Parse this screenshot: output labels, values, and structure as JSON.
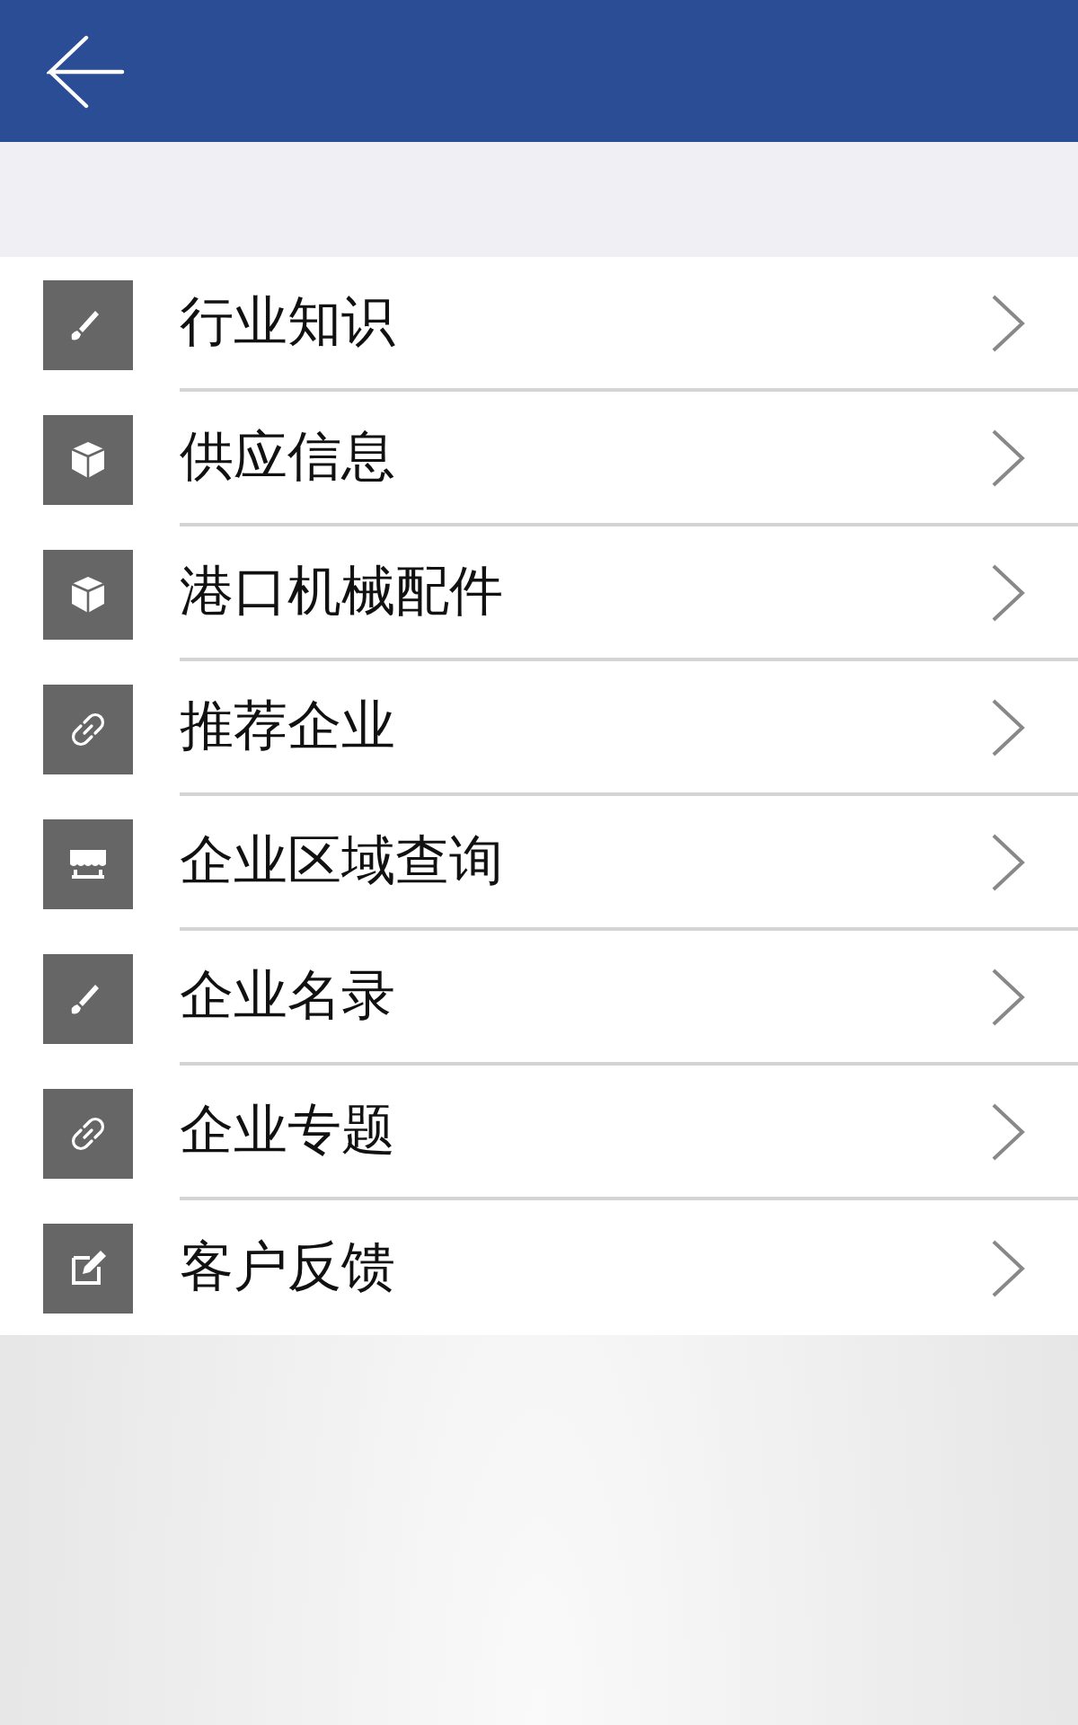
{
  "items": [
    {
      "label": "行业知识",
      "kind": "brush"
    },
    {
      "label": "供应信息",
      "kind": "box"
    },
    {
      "label": "港口机械配件",
      "kind": "box"
    },
    {
      "label": "推荐企业",
      "kind": "link"
    },
    {
      "label": "企业区域查询",
      "kind": "store"
    },
    {
      "label": "企业名录",
      "kind": "brush"
    },
    {
      "label": "企业专题",
      "kind": "link"
    },
    {
      "label": "客户反馈",
      "kind": "edit"
    }
  ]
}
